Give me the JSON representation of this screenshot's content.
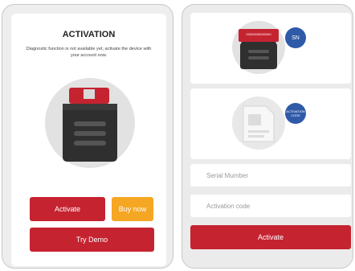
{
  "activation": {
    "title": "ACTIVATION",
    "message": "Diagnostic function is not available yet, activate the device with your account now.",
    "activate_label": "Activate",
    "buy_now_label": "Buy now",
    "try_demo_label": "Try Demo"
  },
  "guide": {
    "serial_label": "00000000000000",
    "sn_badge": "SN",
    "activation_code_badge": "ACTIVATION CODE",
    "serial_placeholder": "Serial Mumber",
    "code_placeholder": "Activation code",
    "activate_label": "Activate"
  },
  "colors": {
    "primary_red": "#c52330",
    "buy_orange": "#f5a623",
    "badge_blue": "#2f5aa8"
  }
}
